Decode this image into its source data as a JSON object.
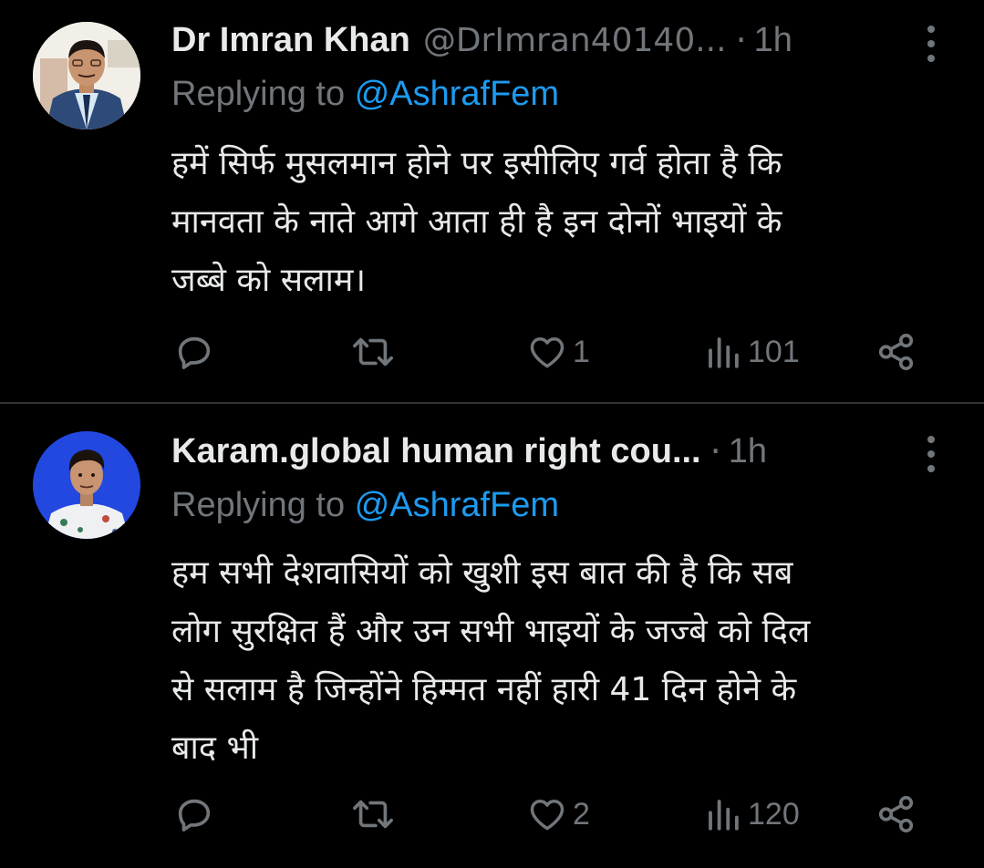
{
  "tweets": [
    {
      "name": "Dr Imran Khan",
      "handle": "@DrImran40140...",
      "separator": "·",
      "time": "1h",
      "reply_prefix": "Replying to",
      "reply_mention": "@AshrafFem",
      "text_lines": [
        "हमें सिर्फ मुसलमान होने पर इसीलिए गर्व होता है कि",
        "मानवता के नाते आगे आता ही है इन दोनों भाइयों के",
        "जब्बे को सलाम।"
      ],
      "likes": "1",
      "views": "101"
    },
    {
      "name": "Karam.global human right cou...",
      "handle": "",
      "separator": "·",
      "time": "1h",
      "reply_prefix": "Replying to",
      "reply_mention": "@AshrafFem",
      "text_lines": [
        "हम सभी देशवासियों को खुशी इस बात की है कि सब",
        "लोग सुरक्षित हैं और उन सभी भाइयों के जज्बे को दिल",
        "से सलाम है जिन्होंने हिम्मत नहीं हारी 41 दिन होने के",
        "बाद भी"
      ],
      "likes": "2",
      "views": "120"
    }
  ],
  "colors": {
    "background": "#000000",
    "text": "#e7e9ea",
    "muted": "#71767b",
    "link": "#1d9bf0",
    "divider": "#2f3336"
  },
  "icons": [
    "reply-icon",
    "retweet-icon",
    "like-icon",
    "views-icon",
    "share-icon",
    "more-icon"
  ]
}
